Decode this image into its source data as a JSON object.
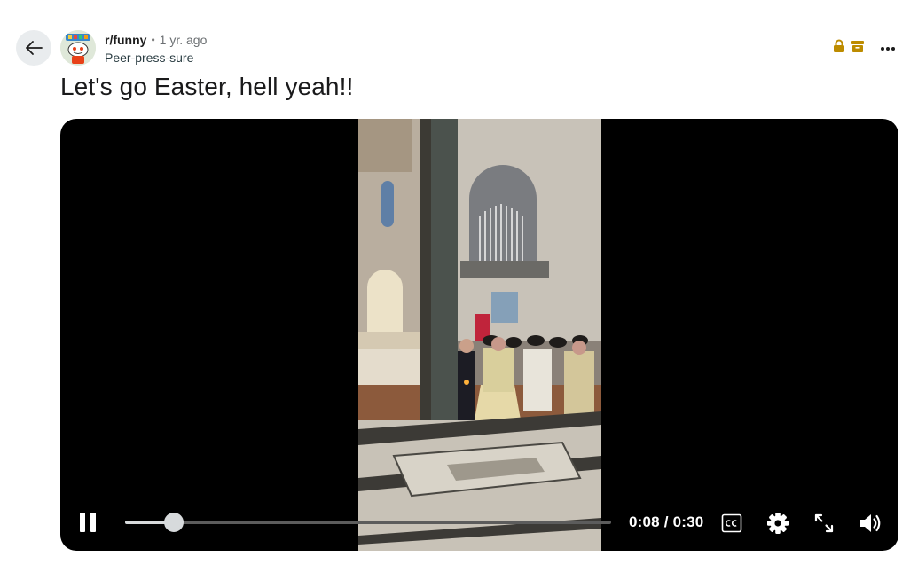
{
  "post": {
    "subreddit": "r/funny",
    "separator": "•",
    "time_ago": "1 yr. ago",
    "username": "Peer-press-sure",
    "title": "Let's go Easter, hell yeah!!"
  },
  "player": {
    "current_time": "0:08",
    "duration": "0:30",
    "time_separator": " / ",
    "progress": 0.1
  },
  "icons": {
    "back": "arrow-left-icon",
    "locked": "lock-icon",
    "archived": "archive-icon",
    "more": "more-horizontal-icon",
    "pause": "pause-icon",
    "captions": "closed-captions-icon",
    "settings": "gear-icon",
    "fullscreen": "expand-icon",
    "volume": "volume-icon"
  },
  "colors": {
    "mod_gold": "#bd8c00",
    "player_bg": "#000000",
    "seek_fill": "#d7dadc"
  }
}
